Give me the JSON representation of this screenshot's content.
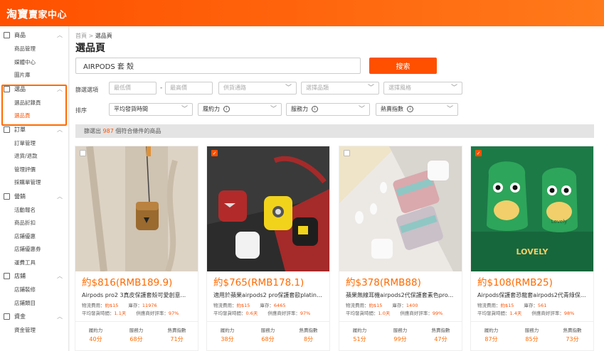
{
  "app": {
    "logo_main": "淘寶",
    "logo_sub": "賣家中心"
  },
  "sidebar": {
    "groups": [
      {
        "label": "商品",
        "items": [
          "商品管理",
          "媒體中心",
          "圖片庫"
        ]
      },
      {
        "label": "選品",
        "items": [
          "選品記錄頁",
          "選品頁"
        ]
      },
      {
        "label": "訂單",
        "items": [
          "訂單管理",
          "退貨/退款",
          "管理評價",
          "採購單管理"
        ]
      },
      {
        "label": "營銷",
        "items": [
          "活動報名",
          "商品折扣",
          "店鋪優惠",
          "店鋪優惠券",
          "運費工具"
        ]
      },
      {
        "label": "店鋪",
        "items": [
          "店鋪裝修",
          "店鋪類目"
        ]
      },
      {
        "label": "資金",
        "items": [
          "資金管理"
        ]
      }
    ],
    "active_item": "選品頁"
  },
  "main": {
    "breadcrumb_home": "首頁",
    "breadcrumb_sep": ">",
    "breadcrumb_current": "選品頁",
    "title": "選品頁",
    "search_value": "AIRPODS 套 殼",
    "search_button": "搜索",
    "filter_label": "篩選選項",
    "price_min_placeholder": "最低價",
    "price_dash": "-",
    "price_max_placeholder": "最高價",
    "channel_placeholder": "供貨通路",
    "category_placeholder": "選擇品類",
    "style_placeholder": "選擇風格",
    "sort_label": "排序",
    "sort_option": "平均發貨時間",
    "sort_performance": "履約力",
    "sort_service": "服務力",
    "sort_hot": "熱賣指數",
    "count_prefix": "篩選出",
    "count_value": "987",
    "count_suffix": "個符合條件的商品"
  },
  "products": [
    {
      "checked": false,
      "price": "約$816(RMB189.9)",
      "name": "Airpods pro2 3真皮保護套殼可愛創意...",
      "shipping_label": "物流費用：",
      "shipping": "約$15",
      "stock_label": "庫存：",
      "stock": "11976",
      "delivery_label": "平均發貨時間：",
      "delivery": "1.1天",
      "rating_label": "供應商好評率：",
      "rating": "97%",
      "score_labels": [
        "履約力",
        "服務力",
        "熱賣指數"
      ],
      "scores": [
        "40分",
        "68分",
        "71分"
      ]
    },
    {
      "checked": true,
      "price": "約$765(RMB178.1)",
      "name": "適用於蘋果airpods2 pro保護套歐platins...",
      "shipping_label": "物流費用：",
      "shipping": "約$15",
      "stock_label": "庫存：",
      "stock": "6465",
      "delivery_label": "平均發貨時間：",
      "delivery": "0.6天",
      "rating_label": "供應商好評率：",
      "rating": "97%",
      "score_labels": [
        "履約力",
        "服務力",
        "熱賣指數"
      ],
      "scores": [
        "38分",
        "68分",
        "8分"
      ]
    },
    {
      "checked": false,
      "price": "約$378(RMB88)",
      "name": "蘋果無線耳機airpods2代保護套素色pro...",
      "shipping_label": "物流費用：",
      "shipping": "約$15",
      "stock_label": "庫存：",
      "stock": "1400",
      "delivery_label": "平均發貨時間：",
      "delivery": "1.0天",
      "rating_label": "供應商好評率：",
      "rating": "99%",
      "score_labels": [
        "履約力",
        "服務力",
        "熱賣指數"
      ],
      "scores": [
        "51分",
        "99分",
        "47分"
      ]
    },
    {
      "checked": true,
      "price": "約$108(RMB25)",
      "name": "Airpods保護套恐龍套airpods2代青綠保...",
      "shipping_label": "物流費用：",
      "shipping": "約$15",
      "stock_label": "庫存：",
      "stock": "561",
      "delivery_label": "平均發貨時間：",
      "delivery": "1.4天",
      "rating_label": "供應商好評率：",
      "rating": "98%",
      "score_labels": [
        "履約力",
        "服務力",
        "熱賣指數"
      ],
      "scores": [
        "87分",
        "85分",
        "73分"
      ]
    }
  ],
  "image_text": {
    "dino_badge": "Lovely",
    "dino_banner": "LOVELY"
  },
  "colors": {
    "brand": "#ff5000",
    "price": "#ff6a00"
  }
}
